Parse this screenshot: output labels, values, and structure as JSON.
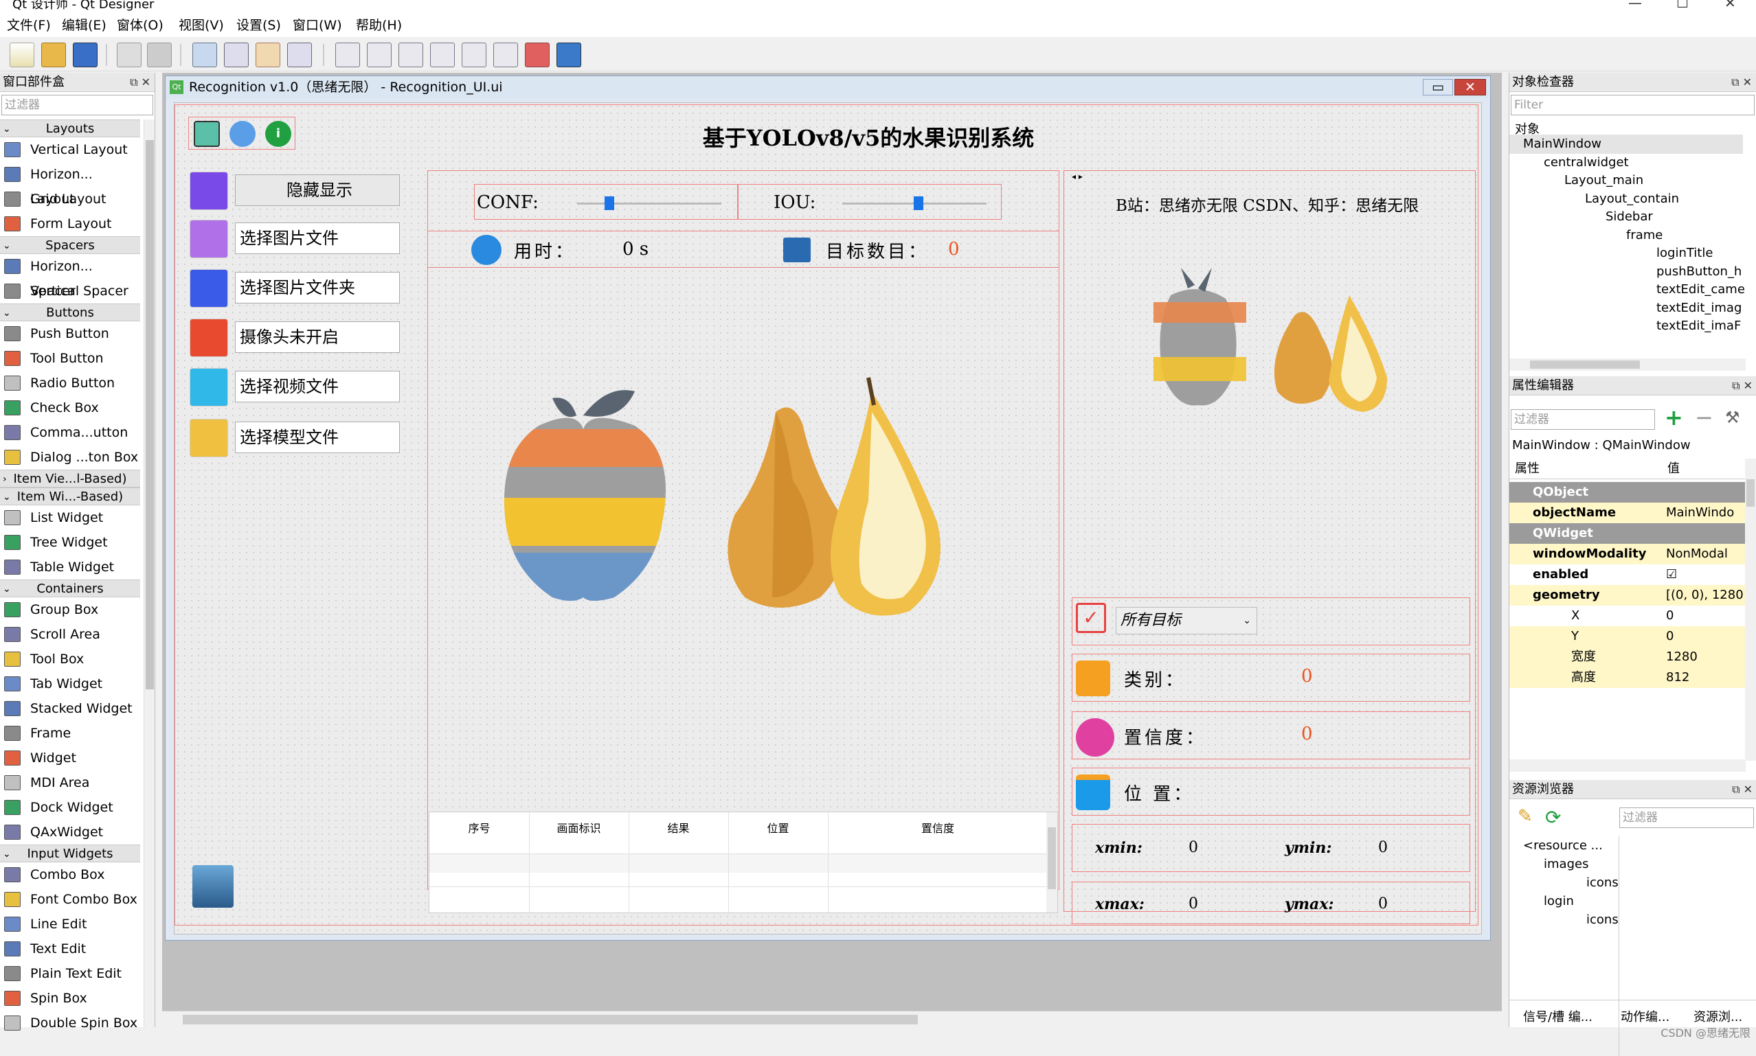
{
  "window": {
    "title": "Qt 设计师 - Qt Designer",
    "controls": [
      "—",
      "☐",
      "✕"
    ]
  },
  "menus": [
    "文件(F)",
    "编辑(E)",
    "窗体(O)",
    "视图(V)",
    "设置(S)",
    "窗口(W)",
    "帮助(H)"
  ],
  "widget_box": {
    "title": "窗口部件盒",
    "filter_placeholder": "过滤器",
    "categories": [
      {
        "name": "Layouts",
        "items": [
          "Vertical Layout",
          "Horizon... Layout",
          "Grid Layout",
          "Form Layout"
        ]
      },
      {
        "name": "Spacers",
        "items": [
          "Horizon... Spacer",
          "Vertical Spacer"
        ]
      },
      {
        "name": "Buttons",
        "items": [
          "Push Button",
          "Tool Button",
          "Radio Button",
          "Check Box",
          "Comma...utton",
          "Dialog ...ton Box"
        ]
      },
      {
        "name": "Item Vie...l-Based)",
        "items": []
      },
      {
        "name": "Item Wi...-Based)",
        "items": [
          "List Widget",
          "Tree Widget",
          "Table Widget"
        ]
      },
      {
        "name": "Containers",
        "items": [
          "Group Box",
          "Scroll Area",
          "Tool Box",
          "Tab Widget",
          "Stacked Widget",
          "Frame",
          "Widget",
          "MDI Area",
          "Dock Widget",
          "QAxWidget"
        ]
      },
      {
        "name": "Input Widgets",
        "items": [
          "Combo Box",
          "Font Combo Box",
          "Line Edit",
          "Text Edit",
          "Plain Text Edit",
          "Spin Box",
          "Double Spin Box"
        ]
      }
    ]
  },
  "form": {
    "title": "Recognition v1.0（思绪无限） - Recognition_UI.ui",
    "heading": "基于YOLOv8/v5的水果识别系统",
    "sidebar": [
      "隐藏显示",
      "选择图片文件",
      "选择图片文件夹",
      "摄像头未开启",
      "选择视频文件",
      "选择模型文件"
    ],
    "conf_label": "CONF:",
    "iou_label": "IOU:",
    "time_label": "用时：",
    "time_value": "0 s",
    "count_label": "目标数目：",
    "count_value": "0",
    "credit": "B站：思绪亦无限  CSDN、知乎：思绪无限",
    "target_select": "所有目标",
    "class_label": "类别：",
    "class_value": "0",
    "conf2_label": "置信度：",
    "conf2_value": "0",
    "pos_label": "位 置：",
    "xmin_label": "xmin:",
    "xmin": "0",
    "ymin_label": "ymin:",
    "ymin": "0",
    "xmax_label": "xmax:",
    "xmax": "0",
    "ymax_label": "ymax:",
    "ymax": "0",
    "table_headers": [
      "序号",
      "画面标识",
      "结果",
      "位置",
      "置信度"
    ]
  },
  "object_inspector": {
    "title": "对象检查器",
    "filter": "Filter",
    "column": "对象",
    "tree": [
      "MainWindow",
      "centralwidget",
      "Layout_main",
      "Layout_contain",
      "Sidebar",
      "frame",
      "loginTitle",
      "pushButton_h",
      "textEdit_came",
      "textEdit_imag",
      "textEdit_imaF"
    ]
  },
  "property_editor": {
    "title": "属性编辑器",
    "filter": "过滤器",
    "context": "MainWindow : QMainWindow",
    "col_prop": "属性",
    "col_val": "值",
    "rows": [
      {
        "k": "QObject",
        "v": "",
        "type": "cat"
      },
      {
        "k": "objectName",
        "v": "MainWindo",
        "type": "y"
      },
      {
        "k": "QWidget",
        "v": "",
        "type": "cat"
      },
      {
        "k": "windowModality",
        "v": "NonModal",
        "type": "y"
      },
      {
        "k": "enabled",
        "v": "☑",
        "type": "w"
      },
      {
        "k": "geometry",
        "v": "[(0, 0), 1280",
        "type": "y"
      },
      {
        "k": "X",
        "v": "0",
        "type": "w"
      },
      {
        "k": "Y",
        "v": "0",
        "type": "y"
      },
      {
        "k": "宽度",
        "v": "1280",
        "type": "y"
      },
      {
        "k": "高度",
        "v": "812",
        "type": "y"
      }
    ]
  },
  "resource_browser": {
    "title": "资源浏览器",
    "filter": "过滤器",
    "tree": [
      "<resource ...",
      "images",
      "icons",
      "login",
      "icons"
    ],
    "tabs": [
      "信号/槽 编...",
      "动作编...",
      "资源浏..."
    ]
  },
  "watermark": "CSDN @思绪无限"
}
